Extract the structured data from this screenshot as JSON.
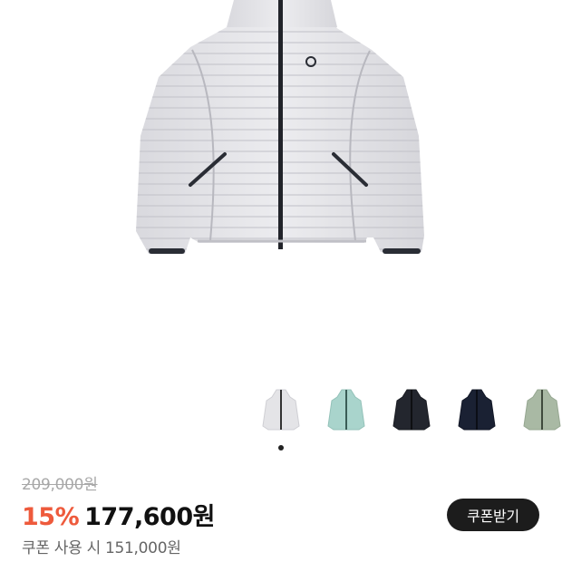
{
  "product": {
    "main_image": "white-puffer-jacket-image",
    "thumbnails": [
      {
        "name": "thumb-white",
        "color": "#e4e4e7"
      },
      {
        "name": "thumb-mint",
        "color": "#a9d4cc"
      },
      {
        "name": "thumb-black",
        "color": "#23262e"
      },
      {
        "name": "thumb-navy",
        "color": "#1a2133"
      },
      {
        "name": "thumb-sage",
        "color": "#a9b9a4"
      }
    ],
    "carousel_position": "1"
  },
  "price": {
    "original": "209,000원",
    "discount": "15%",
    "sale": "177,600원",
    "coupon_price_text": "쿠폰 사용 시 151,000원"
  },
  "coupon_button": {
    "label": "쿠폰받기"
  },
  "colors": {
    "discount": "#ee5a3c",
    "button_bg": "#1c1c1c"
  }
}
